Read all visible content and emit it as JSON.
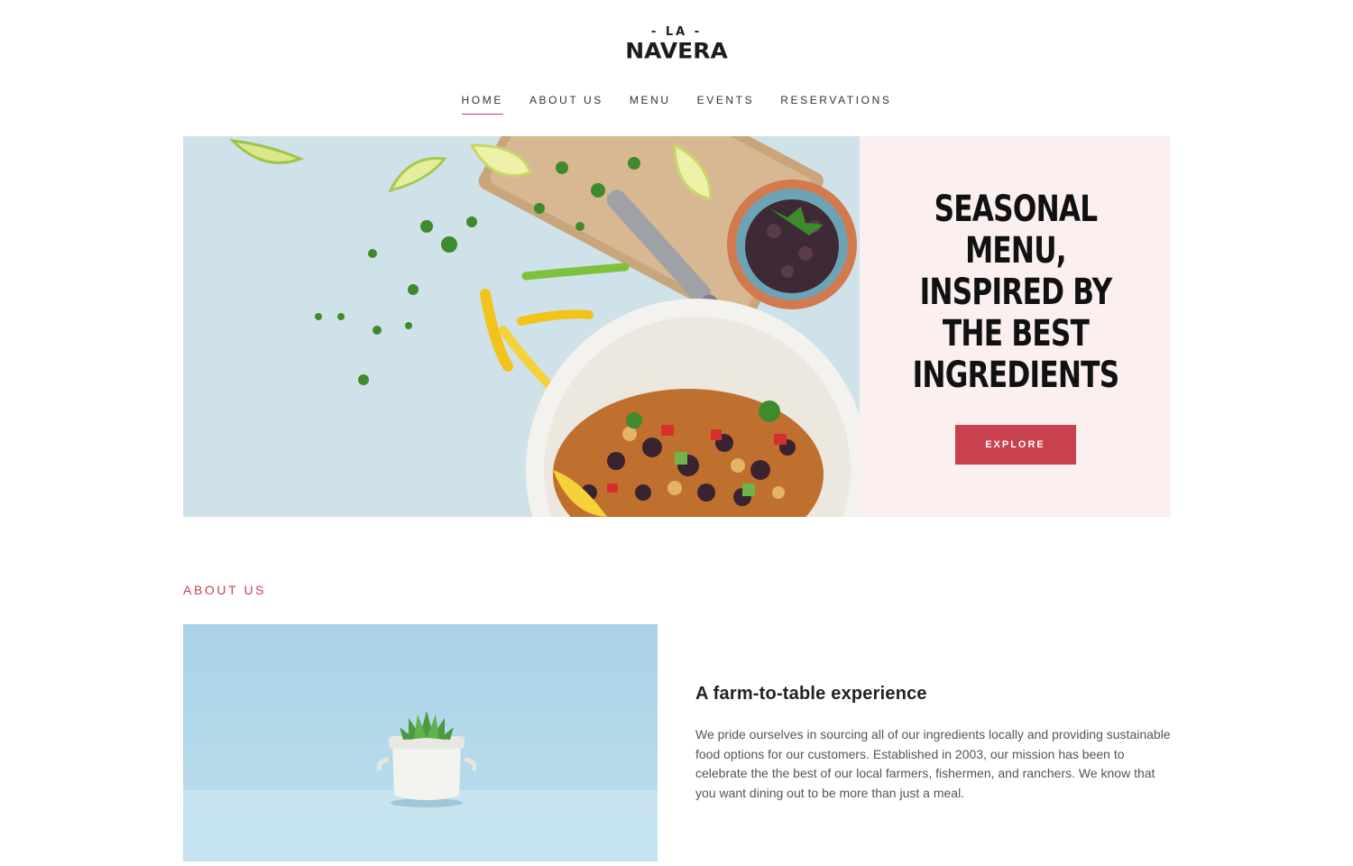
{
  "brand": {
    "logo_top": "- LA -",
    "logo_main": "NAVERA"
  },
  "nav": {
    "items": [
      {
        "label": "HOME",
        "active": true
      },
      {
        "label": "ABOUT US",
        "active": false
      },
      {
        "label": "MENU",
        "active": false
      },
      {
        "label": "EVENTS",
        "active": false
      },
      {
        "label": "RESERVATIONS",
        "active": false
      }
    ]
  },
  "hero": {
    "image_icon": "food-flatlay-photo",
    "headline": "SEASONAL MENU, INSPIRED BY THE BEST INGREDIENTS",
    "button_label": "EXPLORE"
  },
  "about": {
    "section_label": "ABOUT US",
    "image_icon": "succulent-pot-photo",
    "heading": "A farm-to-table experience",
    "body": "We pride ourselves in sourcing all of our ingredients locally and providing sustainable food options for our customers. Established in 2003, our mission has been to celebrate the the best of our local farmers, fishermen, and ranchers. We know that you want dining out to be more than just a meal."
  },
  "colors": {
    "accent": "#c8414f",
    "hero_panel_bg": "#fcefef",
    "hero_image_bg": "#cfe2ea",
    "about_image_bg": "#b7dbeb"
  }
}
